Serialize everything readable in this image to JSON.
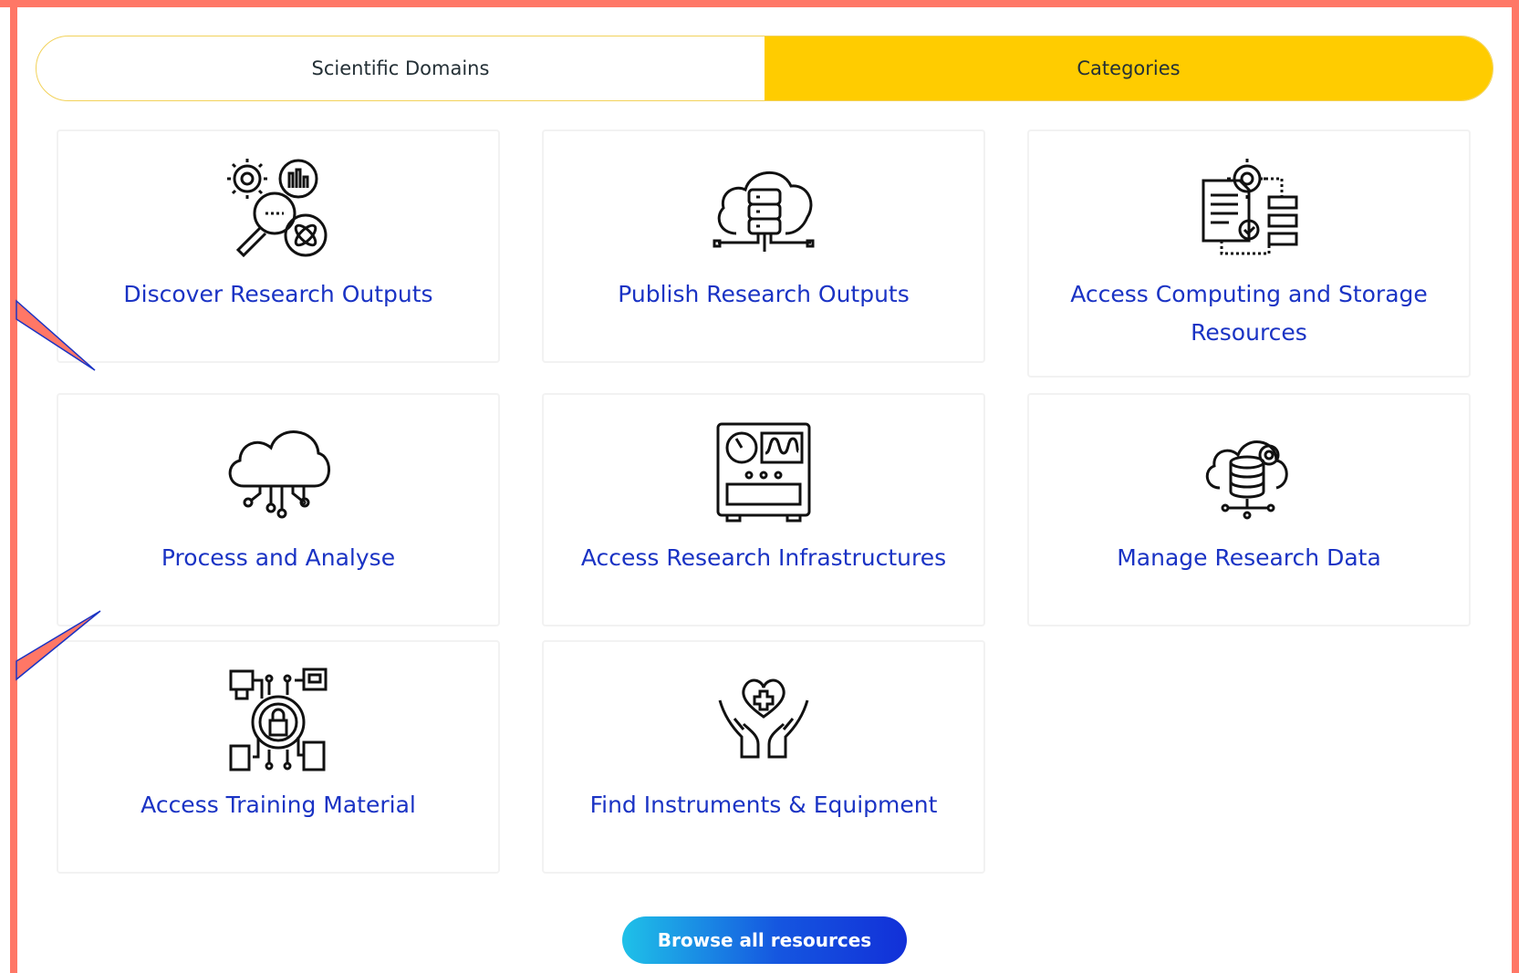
{
  "tabs": [
    {
      "label": "Scientific Domains",
      "active": false
    },
    {
      "label": "Categories",
      "active": true
    }
  ],
  "cards": [
    {
      "label": "Discover Research Outputs",
      "icon": "discover-research-icon"
    },
    {
      "label": "Publish Research Outputs",
      "icon": "cloud-database-icon"
    },
    {
      "label": "Access Computing and Storage Resources",
      "icon": "computing-storage-icon"
    },
    {
      "label": "Process and Analyse",
      "icon": "cloud-circuit-icon"
    },
    {
      "label": "Access Research Infrastructures",
      "icon": "instrument-panel-icon"
    },
    {
      "label": "Manage Research Data",
      "icon": "cloud-data-gear-icon"
    },
    {
      "label": "Access Training Material",
      "icon": "security-network-icon"
    },
    {
      "label": "Find Instruments & Equipment",
      "icon": "heart-hands-icon"
    }
  ],
  "browse_button": {
    "label": "Browse all resources"
  },
  "colors": {
    "frame": "#ff7766",
    "accent": "#ffcc00",
    "link": "#1a33c4",
    "button_start": "#1fc1e8",
    "button_end": "#1230d8"
  }
}
